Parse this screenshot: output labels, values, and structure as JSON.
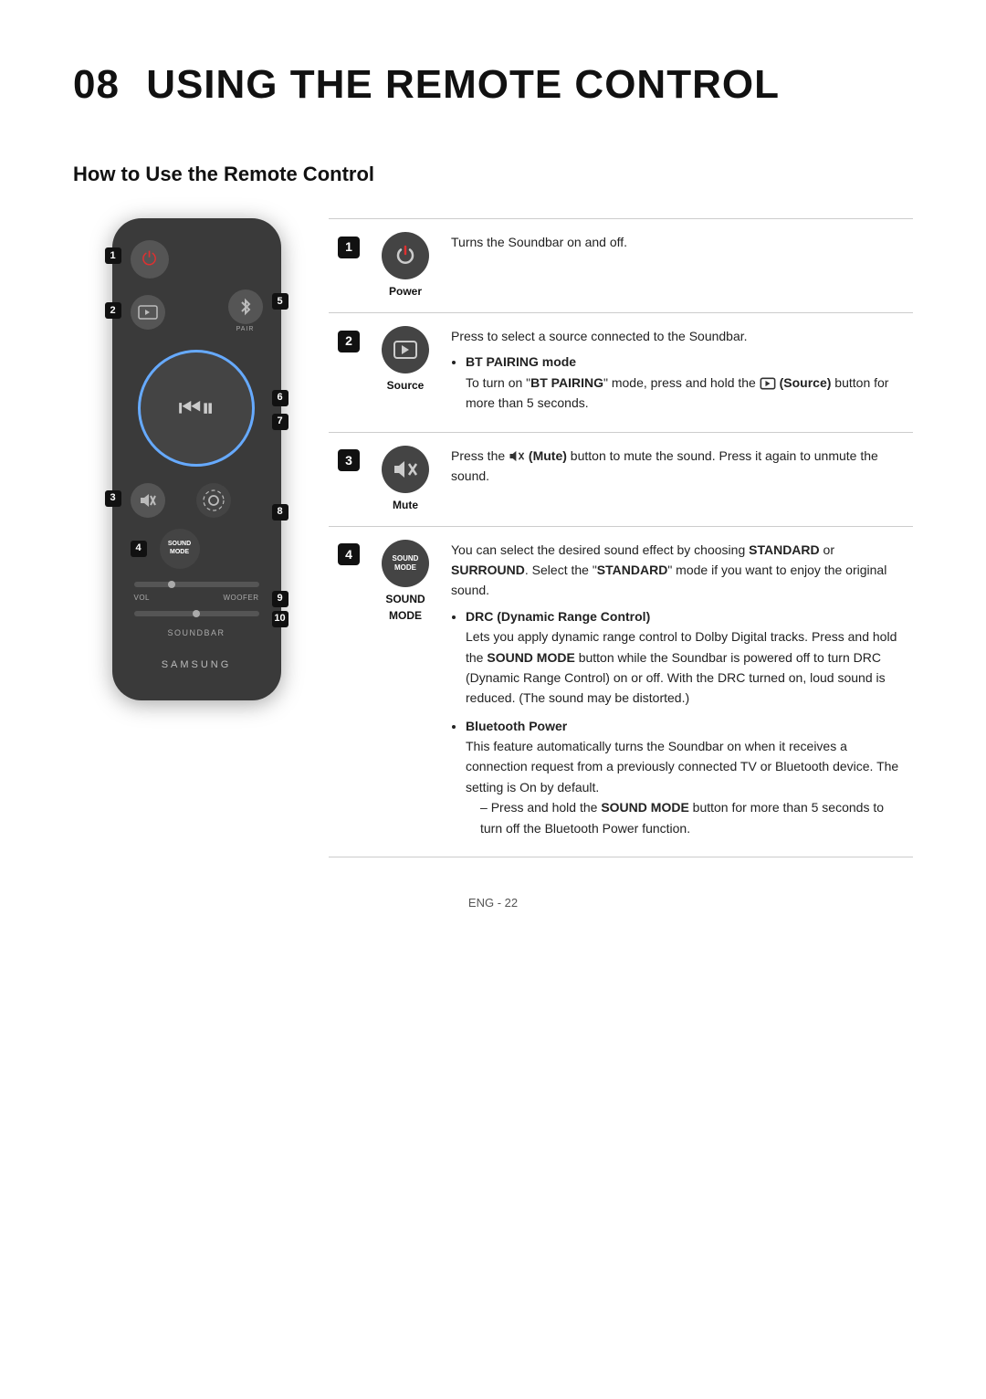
{
  "page": {
    "chapter": "08",
    "title": "USING THE REMOTE CONTROL",
    "section": "How to Use the Remote Control",
    "footer": "ENG - 22"
  },
  "remote": {
    "samsung_label": "SAMSUNG",
    "soundbar_label": "SOUNDBAR",
    "vol_label": "VOL",
    "woofer_label": "WOOFER",
    "pair_label": "PAIR",
    "sound_mode_label": "SOUND\nMODE"
  },
  "table": [
    {
      "num": "1",
      "icon_label": "Power",
      "description": "Turns the Soundbar on and off."
    },
    {
      "num": "2",
      "icon_label": "Source",
      "description": "Press to select a source connected to the Soundbar.",
      "bullets": [
        {
          "bold_text": "BT PAIRING mode",
          "text": "To turn on \"BT PAIRING\" mode, press and hold the  (Source) button for more than 5 seconds.",
          "source_icon": true
        }
      ]
    },
    {
      "num": "3",
      "icon_label": "Mute",
      "description": "Press the  (Mute) button to mute the sound. Press it again to unmute the sound.",
      "mute_icon": true
    },
    {
      "num": "4",
      "icon_label": "SOUND MODE",
      "description": "You can select the desired sound effect by choosing STANDARD or SURROUND. Select the \"STANDARD\" mode if you want to enjoy the original sound.",
      "description_bold_parts": [
        "STANDARD",
        "SURROUND",
        "STANDARD"
      ],
      "bullets": [
        {
          "bold_text": "DRC (Dynamic Range Control)",
          "text": "Lets you apply dynamic range control to Dolby Digital tracks. Press and hold the SOUND MODE button while the Soundbar is powered off to turn DRC (Dynamic Range Control) on or off. With the DRC turned on, loud sound is reduced. (The sound may be distorted.)",
          "bold_in_text": "SOUND MODE"
        },
        {
          "bold_text": "Bluetooth Power",
          "text": "This feature automatically turns the Soundbar on when it receives a connection request from a previously connected TV or Bluetooth device. The setting is On by default.",
          "sub_bullets": [
            "Press and hold the SOUND MODE button for more than 5 seconds to turn off the Bluetooth Power function."
          ],
          "sub_bold": "SOUND MODE"
        }
      ]
    }
  ]
}
